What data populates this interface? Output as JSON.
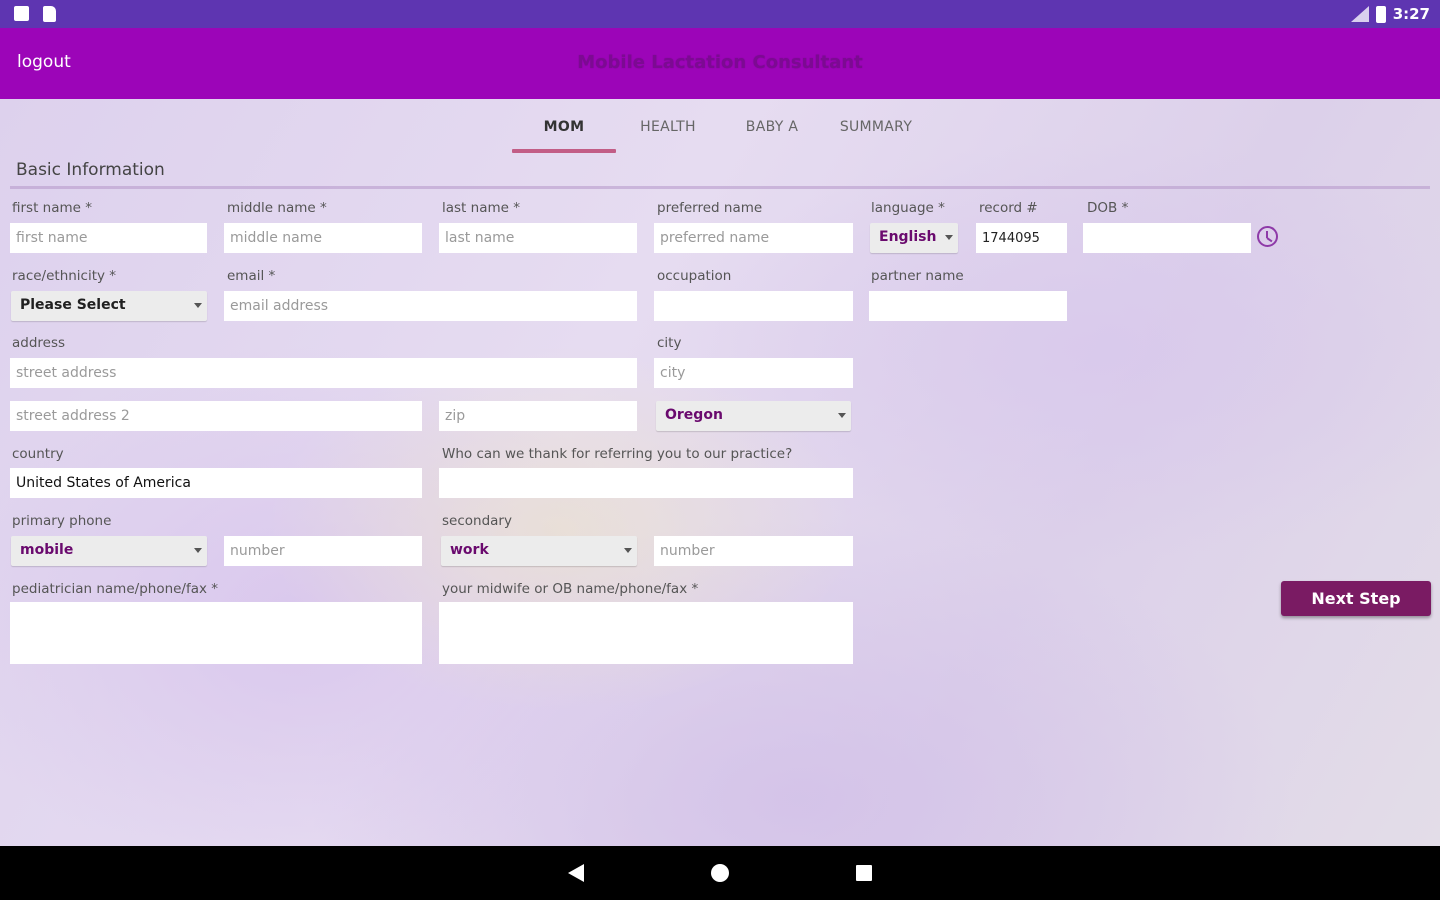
{
  "statusbar": {
    "time": "3:27",
    "left_icons": [
      "photo-icon",
      "document-icon"
    ],
    "right_icons": [
      "signal-icon",
      "battery-icon"
    ]
  },
  "appbar": {
    "logout": "logout",
    "title": "Mobile Lactation Consultant",
    "color": "#9c05b8"
  },
  "tabs": [
    {
      "label": "MOM",
      "active": true
    },
    {
      "label": "HEALTH",
      "active": false
    },
    {
      "label": "BABY A",
      "active": false
    },
    {
      "label": "SUMMARY",
      "active": false
    }
  ],
  "section_title": "Basic Information",
  "form": {
    "first_name": {
      "label": "first name *",
      "placeholder": "first name",
      "value": ""
    },
    "middle_name": {
      "label": "middle name *",
      "placeholder": "middle name",
      "value": ""
    },
    "last_name": {
      "label": "last name *",
      "placeholder": "last name",
      "value": ""
    },
    "preferred_name": {
      "label": "preferred name",
      "placeholder": "preferred name",
      "value": ""
    },
    "language": {
      "label": "language *",
      "selected": "English"
    },
    "record": {
      "label": "record #",
      "value": "1744095"
    },
    "dob": {
      "label": "DOB *",
      "value": ""
    },
    "race": {
      "label": "race/ethnicity *",
      "selected": "Please Select"
    },
    "email": {
      "label": "email *",
      "placeholder": "email address",
      "value": ""
    },
    "occupation": {
      "label": "occupation",
      "value": ""
    },
    "partner_name": {
      "label": "partner name",
      "value": ""
    },
    "address": {
      "label": "address",
      "placeholder": "street address",
      "placeholder2": "street address 2"
    },
    "city": {
      "label": "city",
      "placeholder": "city"
    },
    "zip": {
      "placeholder": "zip"
    },
    "state": {
      "selected": "Oregon"
    },
    "country": {
      "label": "country",
      "value": "United States of America"
    },
    "referral": {
      "label": "Who can we thank for referring you to our practice?",
      "value": ""
    },
    "primary_phone": {
      "label": "primary phone",
      "type": "mobile",
      "placeholder": "number"
    },
    "secondary_phone": {
      "label": "secondary",
      "type": "work",
      "placeholder": "number"
    },
    "pediatrician": {
      "label": "pediatrician name/phone/fax *",
      "value": ""
    },
    "midwife": {
      "label": "your midwife or OB name/phone/fax *",
      "value": ""
    }
  },
  "next_button": "Next Step",
  "accent_color": "#7a1b63"
}
